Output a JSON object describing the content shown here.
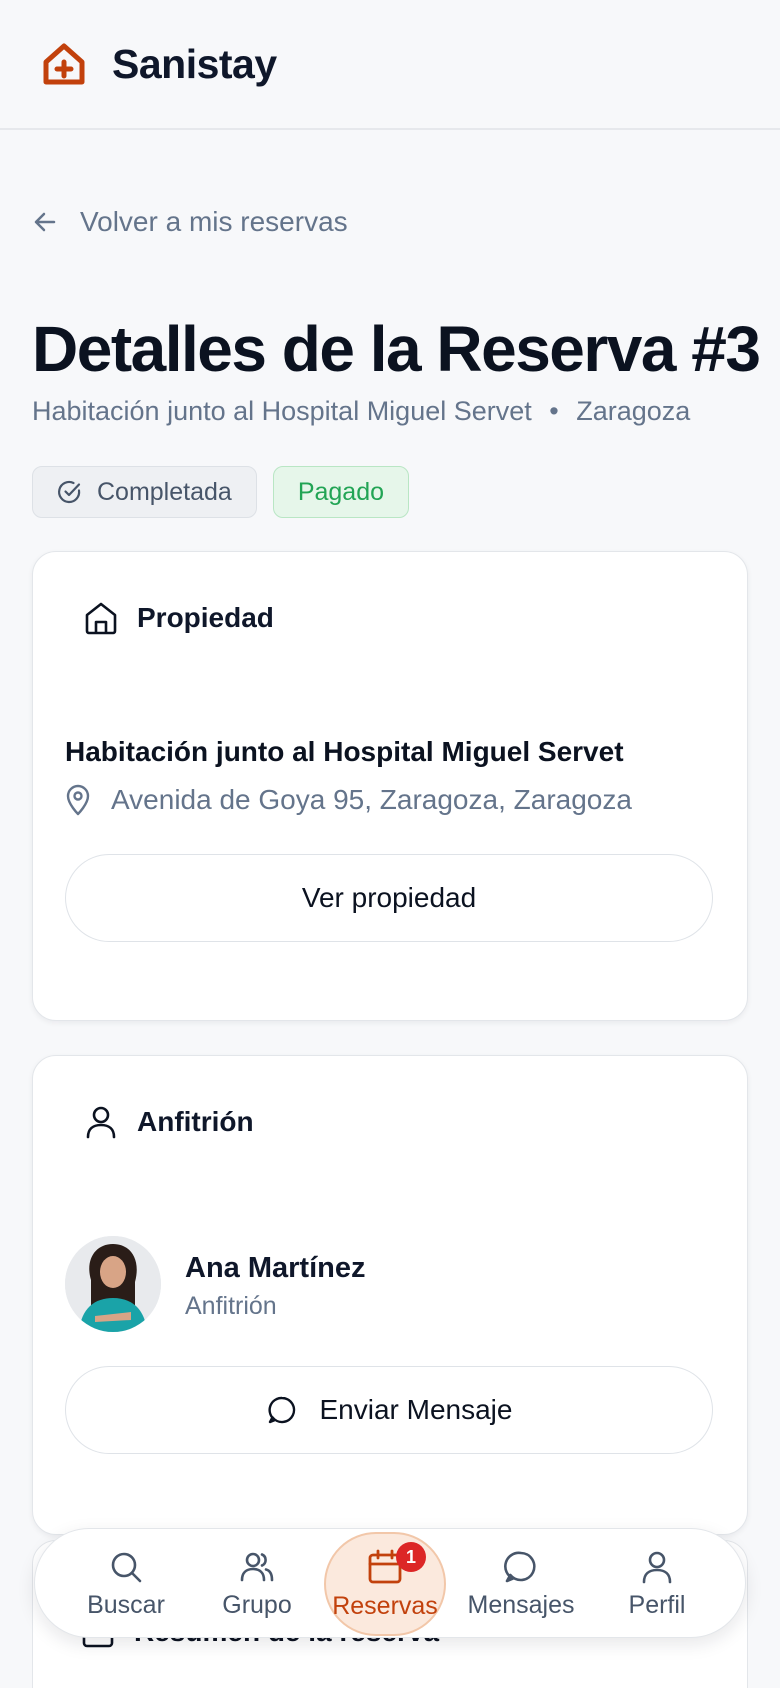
{
  "app": {
    "brand": "Sanistay",
    "brand_color": "#c2410c"
  },
  "nav": {
    "back_label": "Volver a mis reservas"
  },
  "booking": {
    "title": "Detalles de la Reserva #3",
    "property_title": "Habitación junto al Hospital Miguel Servet",
    "separator": "•",
    "city": "Zaragoza",
    "status_label": "Completada",
    "payment_label": "Pagado"
  },
  "property_card": {
    "header": "Propiedad",
    "name": "Habitación junto al Hospital Miguel Servet",
    "address": "Avenida de Goya 95, Zaragoza, Zaragoza",
    "button_label": "Ver propiedad"
  },
  "host_card": {
    "header": "Anfitrión",
    "name": "Ana Martínez",
    "role": "Anfitrión",
    "button_label": "Enviar Mensaje"
  },
  "summary_card": {
    "header": "Resumen de la reserva"
  },
  "tabbar": {
    "items": [
      {
        "label": "Buscar",
        "icon": "search-icon"
      },
      {
        "label": "Grupo",
        "icon": "group-icon"
      },
      {
        "label": "Reservas",
        "icon": "calendar-icon",
        "badge": "1",
        "active": true
      },
      {
        "label": "Mensajes",
        "icon": "message-icon"
      },
      {
        "label": "Perfil",
        "icon": "user-icon"
      }
    ]
  }
}
